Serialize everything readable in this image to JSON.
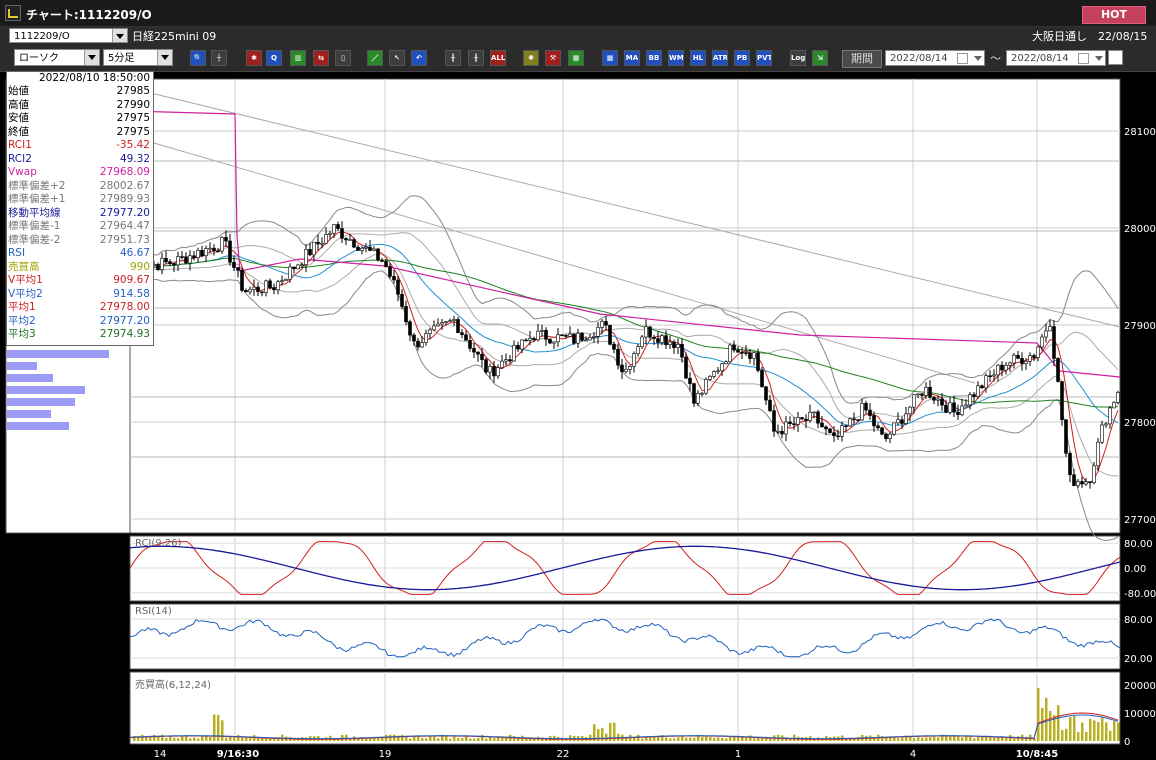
{
  "window": {
    "title": "チャート:1112209/O",
    "hot_label": "HOT"
  },
  "symbol_bar": {
    "code": "1112209/O",
    "instrument": "日経225mini 09",
    "session": "大阪日通し　22/08/15"
  },
  "chart_type": "ローソク",
  "timeframe": "5分足",
  "toolbar": {
    "buttons": [
      "search-icon",
      "crosshair-icon",
      "tool-icon",
      "zoom-icon",
      "chart-icon",
      "compare-icon",
      "memo-icon",
      "pen-icon",
      "cursor-icon",
      "undo-icon",
      "bar-icon",
      "bar2-icon",
      "all-icon",
      "gear-icon",
      "wrench-icon",
      "palette-icon",
      "grid-icon",
      "ma-icon",
      "bb-icon",
      "wma-icon",
      "hl-icon",
      "atr-icon",
      "parabolic-icon",
      "pvt-icon",
      "log-icon",
      "export-icon"
    ],
    "labels": {
      "ma": "MA",
      "bb": "BB",
      "wma": "WMA",
      "hl": "HL",
      "atr": "ATR",
      "pb": "PB",
      "pvt": "PVT",
      "log": "Log",
      "all": "ALL"
    },
    "period_label": "期間",
    "date_from": "2022/08/14",
    "date_to": "2022/08/14",
    "separator": "～"
  },
  "info_panel": {
    "timestamp": "2022/08/10  18:50:00",
    "rows": [
      {
        "label": "始値",
        "value": "27985",
        "color": "#000000"
      },
      {
        "label": "高値",
        "value": "27990",
        "color": "#000000"
      },
      {
        "label": "安値",
        "value": "27975",
        "color": "#000000"
      },
      {
        "label": "終値",
        "value": "27975",
        "color": "#000000"
      },
      {
        "label": "RCI1",
        "value": "-35.42",
        "color": "#d02020"
      },
      {
        "label": "RCI2",
        "value": "49.32",
        "color": "#1a1a9a"
      },
      {
        "label": "Vwap",
        "value": "27968.09",
        "color": "#d020a0"
      },
      {
        "label": "標準偏差+2",
        "value": "28002.67",
        "color": "#777777"
      },
      {
        "label": "標準偏差+1",
        "value": "27989.93",
        "color": "#777777"
      },
      {
        "label": "移動平均線",
        "value": "27977.20",
        "color": "#1a1a9a"
      },
      {
        "label": "標準偏差-1",
        "value": "27964.47",
        "color": "#777777"
      },
      {
        "label": "標準偏差-2",
        "value": "27951.73",
        "color": "#777777"
      },
      {
        "label": "RSI",
        "value": "46.67",
        "color": "#2060c0"
      },
      {
        "label": "売買高",
        "value": "990",
        "color": "#a0a000"
      },
      {
        "label": "V平均1",
        "value": "909.67",
        "color": "#d02020"
      },
      {
        "label": "V平均2",
        "value": "914.58",
        "color": "#2060c0"
      },
      {
        "label": "平均1",
        "value": "27978.00",
        "color": "#d02020"
      },
      {
        "label": "平均2",
        "value": "27977.20",
        "color": "#2060c0"
      },
      {
        "label": "平均3",
        "value": "27974.93",
        "color": "#207020"
      }
    ]
  },
  "price_axis": {
    "ticks": [
      "28100",
      "28000",
      "27900",
      "27800",
      "27700"
    ]
  },
  "x_axis": {
    "ticks": [
      "14",
      "9/16:30",
      "19",
      "22",
      "1",
      "4",
      "10/8:45"
    ]
  },
  "rci_panel": {
    "label": "RCI(9,26)",
    "ticks": [
      "80.00",
      "0.00",
      "-80.00"
    ]
  },
  "rsi_panel": {
    "label": "RSI(14)",
    "ticks": [
      "80.00",
      "20.00"
    ]
  },
  "vol_panel": {
    "label": "売買高(6,12,24)",
    "ticks": [
      "20000",
      "10000",
      "0"
    ]
  },
  "colors": {
    "bg": "#ffffff",
    "hot": "#c4405c",
    "rci1": "#d02020",
    "rci2": "#1a1a9a",
    "rsi": "#2060c0",
    "vwap": "#d020a0",
    "volume": "#b8b020"
  }
}
